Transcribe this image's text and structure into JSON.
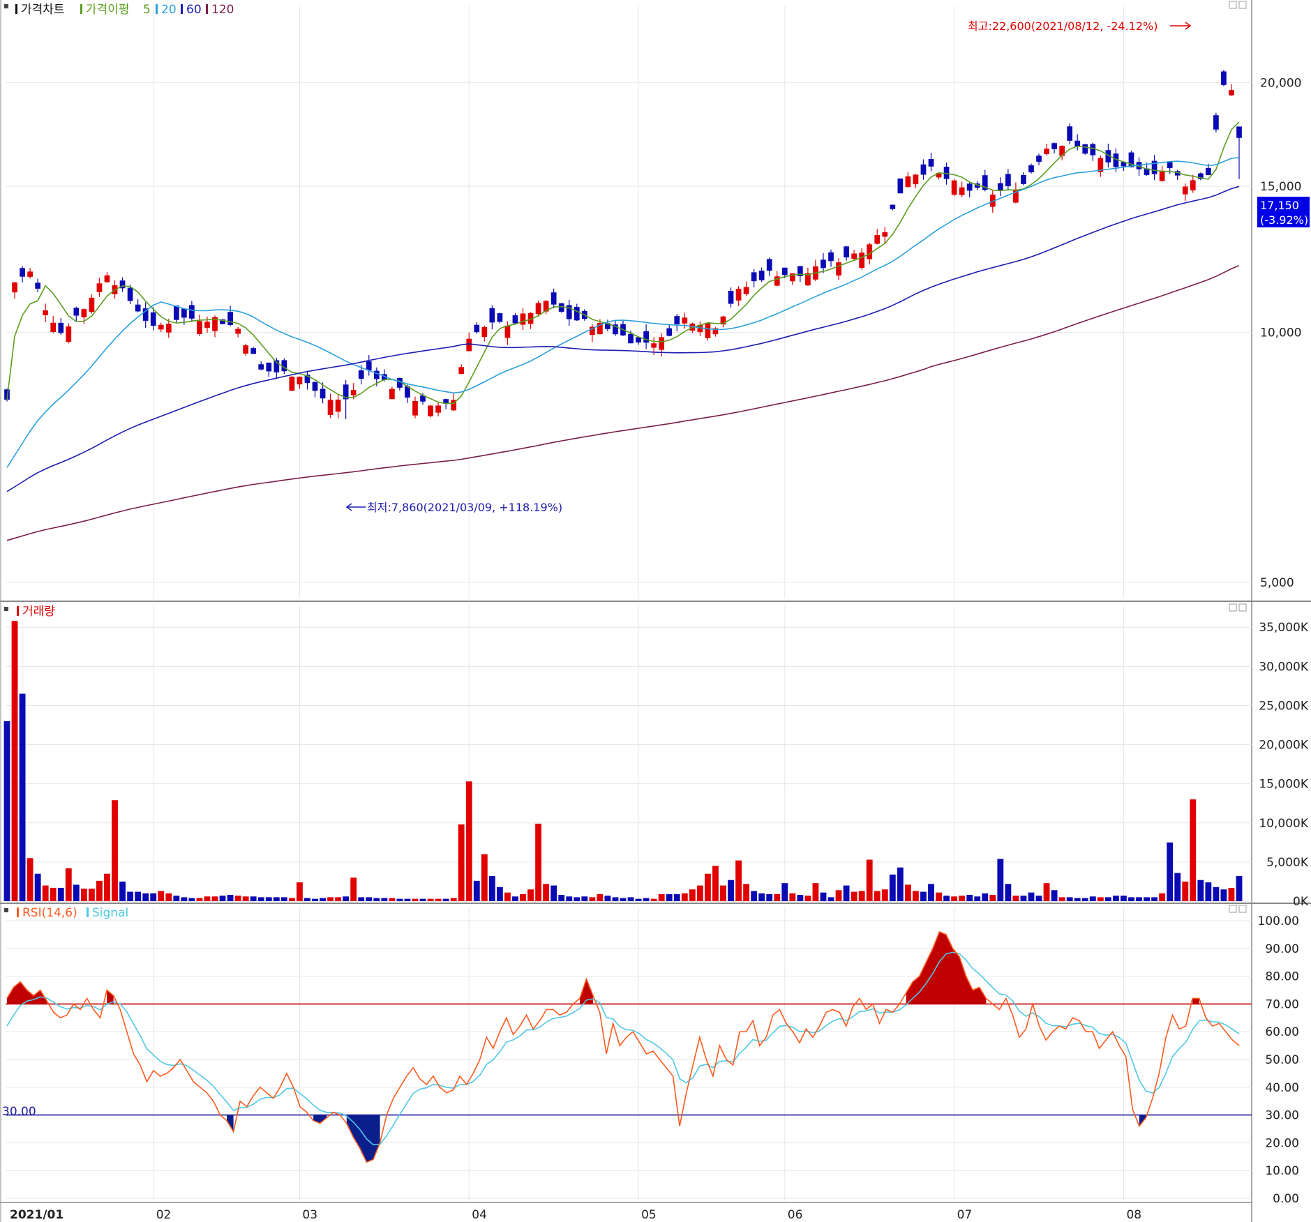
{
  "panels": {
    "price": {
      "title": "가격차트",
      "ma_label": "가격이평",
      "ma_periods": [
        "5",
        "20",
        "60",
        "120"
      ],
      "ma_colors": [
        "#5a9e1e",
        "#2aa0dc",
        "#1c1cb0",
        "#7b1e4a"
      ]
    },
    "volume": {
      "title": "거래량"
    },
    "rsi": {
      "title": "RSI(14,6)",
      "signal_label": "Signal",
      "level_label": "30.00"
    }
  },
  "x_axis": {
    "month_labels": [
      "2021/01",
      "02",
      "03",
      "04",
      "05",
      "06",
      "07",
      "08"
    ]
  },
  "annotations": {
    "high": "최고:22,600(2021/08/12, -24.12%)",
    "low": "최저:7,860(2021/03/09, +118.19%)",
    "last_price": "17,150",
    "last_change": "(-3.92%)"
  },
  "colors": {
    "up": "#e00000",
    "down": "#0a0ab4",
    "rsi_line": "#ff5a1e",
    "signal_line": "#4ec8e6",
    "overbought_fill": "#c00000",
    "oversold_fill": "#0a1e8c",
    "level70": "#c00000",
    "level30": "#1c1ca0",
    "grid": "#e6e6e6"
  },
  "chart_data": [
    {
      "type": "candlestick",
      "panel": "price",
      "title": "가격차트",
      "y_ticks": [
        "5,000",
        "10,000",
        "15,000",
        "20,000"
      ],
      "y_tick_values": [
        5000,
        10000,
        15000,
        20000
      ],
      "ylim": [
        4800,
        24000
      ],
      "y_scale": "log",
      "key_points": [
        {
          "date": "2021-03-09",
          "low": 7860
        },
        {
          "date": "2021-08-12",
          "high": 22600
        },
        {
          "date": "2021-08-20",
          "close": 17150,
          "change_pct": -3.92
        }
      ],
      "series": [
        {
          "name": "5",
          "kind": "ma"
        },
        {
          "name": "20",
          "kind": "ma"
        },
        {
          "name": "60",
          "kind": "ma"
        },
        {
          "name": "120",
          "kind": "ma"
        }
      ]
    },
    {
      "type": "bar",
      "panel": "volume",
      "title": "거래량",
      "y_ticks": [
        "0K",
        "5,000K",
        "10,000K",
        "15,000K",
        "20,000K",
        "25,000K",
        "30,000K",
        "35,000K"
      ],
      "y_tick_values": [
        0,
        5000,
        10000,
        15000,
        20000,
        25000,
        30000,
        35000
      ],
      "ylim": [
        0,
        36000
      ],
      "unit": "K",
      "values_k": [
        23000,
        35800,
        26500,
        5500,
        3500,
        2000,
        1700,
        1700,
        4200,
        2100,
        1600,
        1600,
        2600,
        3500,
        12900,
        2500,
        1200,
        1200,
        1000,
        1000,
        1300,
        1000,
        700,
        500,
        400,
        400,
        600,
        600,
        700,
        800,
        700,
        600,
        600,
        500,
        500,
        500,
        500,
        400,
        2400,
        400,
        300,
        400,
        500,
        500,
        600,
        3000,
        500,
        500,
        400,
        400,
        400,
        300,
        300,
        300,
        300,
        300,
        300,
        300,
        400,
        9800,
        15300,
        2600,
        6000,
        3200,
        1800,
        1100,
        600,
        900,
        1500,
        9900,
        2200,
        2000,
        800,
        600,
        500,
        600,
        500,
        900,
        700,
        500,
        400,
        500,
        300,
        400,
        300,
        900,
        900,
        900,
        1000,
        1500,
        2000,
        3500,
        4500,
        2000,
        2700,
        5200,
        2200,
        1300,
        1000,
        900,
        900,
        2300,
        1000,
        800,
        700,
        2300,
        1100,
        500,
        1400,
        2000,
        1200,
        1300,
        5300,
        1300,
        1500,
        3400,
        4300,
        2100,
        1300,
        1200,
        2200,
        1100,
        700,
        600,
        700,
        800,
        600,
        1000,
        800,
        5400,
        2200,
        700,
        700,
        1100,
        700,
        2300,
        1400,
        500,
        500,
        400,
        400,
        600,
        500,
        500,
        700,
        700,
        500,
        500,
        500,
        500,
        1000,
        7500,
        3600,
        2500,
        13000,
        2700,
        2400,
        1800,
        1500,
        1700,
        3200
      ],
      "up_flags": [
        false,
        true,
        false,
        true,
        false,
        true,
        true,
        false,
        true,
        false,
        true,
        true,
        true,
        true,
        true,
        false,
        false,
        false,
        false,
        false,
        true,
        true,
        false,
        false,
        false,
        true,
        true,
        true,
        false,
        false,
        true,
        true,
        false,
        false,
        false,
        false,
        false,
        true,
        true,
        false,
        false,
        false,
        true,
        true,
        false,
        true,
        false,
        false,
        false,
        false,
        true,
        false,
        false,
        true,
        false,
        true,
        true,
        false,
        true,
        true,
        true,
        false,
        true,
        false,
        false,
        true,
        false,
        true,
        true,
        true,
        true,
        false,
        false,
        false,
        false,
        false,
        true,
        true,
        false,
        false,
        false,
        false,
        false,
        false,
        true,
        true,
        false,
        false,
        true,
        true,
        true,
        true,
        true,
        true,
        false,
        true,
        true,
        false,
        false,
        false,
        true,
        false,
        true,
        false,
        true,
        true,
        false,
        false,
        true,
        false,
        true,
        true,
        true,
        true,
        true,
        false,
        false,
        true,
        true,
        false,
        false,
        true,
        false,
        true,
        true,
        false,
        false,
        false,
        true,
        false,
        false,
        true,
        false,
        false,
        false,
        true,
        false,
        true,
        false,
        false,
        false,
        false,
        true,
        false,
        false,
        false,
        false,
        false,
        false,
        false,
        true,
        false,
        false,
        true,
        true,
        false,
        false,
        false,
        false,
        true,
        false,
        false
      ]
    },
    {
      "type": "line",
      "panel": "rsi",
      "title": "RSI(14,6)",
      "y_ticks": [
        "0.00",
        "10.00",
        "20.00",
        "30.00",
        "40.00",
        "50.00",
        "60.00",
        "70.00",
        "80.00",
        "90.00",
        "100.00"
      ],
      "y_tick_values": [
        0,
        10,
        20,
        30,
        40,
        50,
        60,
        70,
        80,
        90,
        100
      ],
      "ylim": [
        0,
        100
      ],
      "levels": [
        30,
        70
      ],
      "series": [
        {
          "name": "RSI(14,6)",
          "values": [
            72,
            76,
            78,
            75,
            73,
            75,
            71,
            67,
            65,
            66,
            70,
            68,
            72,
            68,
            65,
            75,
            73,
            68,
            60,
            52,
            48,
            42,
            46,
            44,
            45,
            47,
            50,
            46,
            42,
            40,
            38,
            35,
            30,
            28,
            24,
            35,
            33,
            37,
            40,
            38,
            36,
            40,
            45,
            40,
            33,
            31,
            28,
            27,
            29,
            31,
            30,
            27,
            22,
            18,
            13,
            14,
            20,
            30,
            36,
            40,
            44,
            47,
            43,
            41,
            44,
            40,
            38,
            39,
            44,
            41,
            45,
            50,
            58,
            54,
            60,
            65,
            59,
            62,
            66,
            61,
            64,
            68,
            68,
            66,
            67,
            70,
            72,
            79,
            73,
            67,
            52,
            63,
            55,
            58,
            60,
            56,
            52,
            53,
            50,
            47,
            44,
            26,
            38,
            48,
            58,
            50,
            44,
            55,
            50,
            48,
            60,
            60,
            64,
            55,
            58,
            66,
            68,
            63,
            60,
            56,
            61,
            58,
            62,
            67,
            68,
            67,
            62,
            69,
            72,
            68,
            70,
            63,
            68,
            67,
            70,
            74,
            78,
            80,
            85,
            90,
            96,
            95,
            90,
            87,
            80,
            75,
            76,
            72,
            70,
            68,
            72,
            66,
            58,
            61,
            70,
            62,
            57,
            60,
            62,
            61,
            65,
            64,
            60,
            60,
            54,
            57,
            60,
            55,
            51,
            32,
            26,
            29,
            36,
            45,
            58,
            66,
            61,
            62,
            72,
            72,
            65,
            62,
            63,
            60,
            57,
            55
          ]
        },
        {
          "name": "Signal"
        }
      ]
    }
  ]
}
